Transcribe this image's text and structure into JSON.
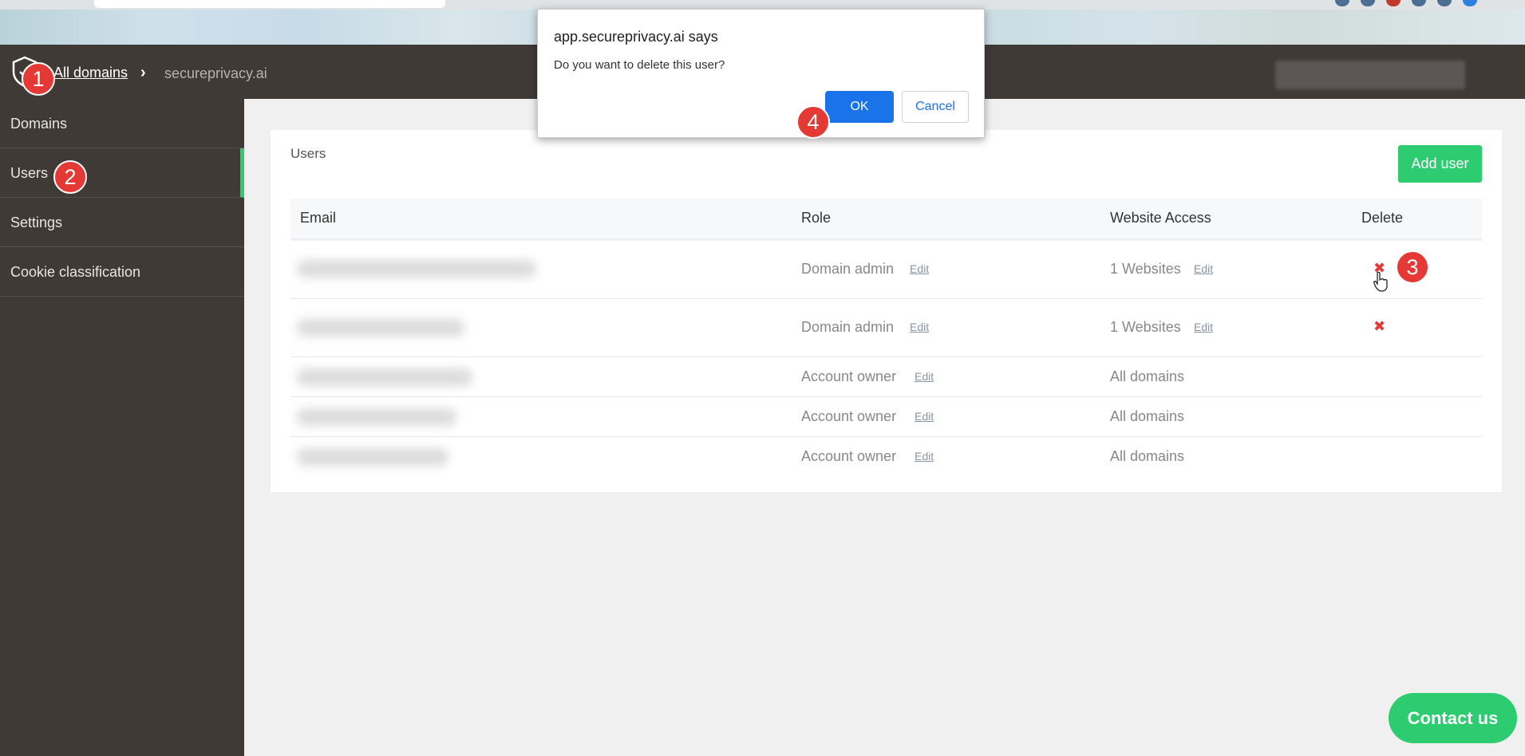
{
  "dialog": {
    "title": "app.secureprivacy.ai says",
    "message": "Do you want to delete this user?",
    "ok_label": "OK",
    "cancel_label": "Cancel"
  },
  "topbar": {
    "breadcrumb_link": "All domains",
    "breadcrumb_sep": "›",
    "breadcrumb_current": "secureprivacy.ai"
  },
  "sidebar": {
    "items": [
      {
        "label": "Domains"
      },
      {
        "label": "Users"
      },
      {
        "label": "Settings"
      },
      {
        "label": "Cookie classification"
      }
    ]
  },
  "users": {
    "title": "Users",
    "add_label": "Add user",
    "columns": [
      "Email",
      "Role",
      "Website Access",
      "Delete"
    ],
    "edit_label": "Edit",
    "delete_symbol": "✖",
    "rows": [
      {
        "role": "Domain admin",
        "access": "1 Websites"
      },
      {
        "role": "Domain admin",
        "access": "1 Websites"
      },
      {
        "role": "Account owner",
        "access": "All domains"
      },
      {
        "role": "Account owner",
        "access": "All domains"
      },
      {
        "role": "Account owner",
        "access": "All domains"
      }
    ]
  },
  "badges": [
    "1",
    "2",
    "3",
    "4"
  ],
  "contact_label": "Contact us",
  "colors": {
    "accent_green": "#2ecc71",
    "dark_bar": "#403a36",
    "delete_red": "#e53935",
    "dialog_blue": "#1a73e8"
  }
}
